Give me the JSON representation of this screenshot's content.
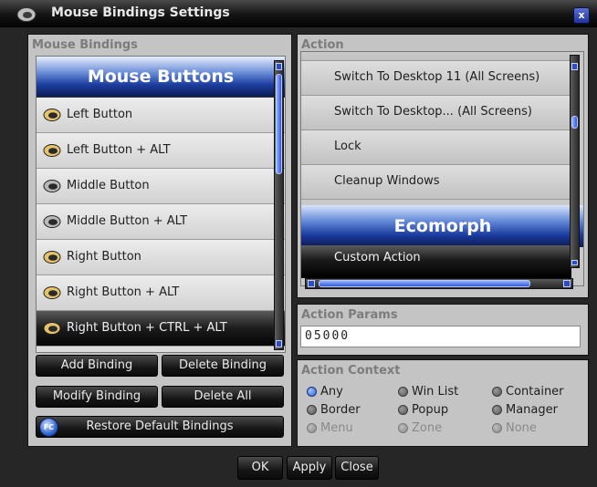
{
  "window": {
    "title": "Mouse Bindings Settings",
    "close_label": "x"
  },
  "mouse_bindings": {
    "section_label": "Mouse Bindings",
    "header": "Mouse Buttons",
    "items": [
      {
        "label": "Left Button"
      },
      {
        "label": "Left Button + ALT"
      },
      {
        "label": "Middle Button"
      },
      {
        "label": "Middle Button + ALT"
      },
      {
        "label": "Right Button"
      },
      {
        "label": "Right Button + ALT"
      },
      {
        "label": "Right Button + CTRL + ALT",
        "selected": true
      }
    ]
  },
  "binding_buttons": {
    "add": "Add Binding",
    "delete": "Delete Binding",
    "modify": "Modify Binding",
    "delete_all": "Delete All",
    "restore": "Restore Default Bindings",
    "restore_icon_text": "FC"
  },
  "action": {
    "section_label": "Action",
    "items_before": [
      "Switch To Desktop 11 (All Screens)",
      "Switch To Desktop... (All Screens)",
      "Lock",
      "Cleanup Windows"
    ],
    "group_header": "Ecomorph",
    "selected_item": "Custom Action"
  },
  "action_params": {
    "section_label": "Action Params",
    "value": "05000"
  },
  "action_context": {
    "section_label": "Action Context",
    "options": [
      {
        "label": "Any",
        "state": "on"
      },
      {
        "label": "Win List",
        "state": "off"
      },
      {
        "label": "Container",
        "state": "off"
      },
      {
        "label": "Border",
        "state": "off"
      },
      {
        "label": "Popup",
        "state": "off"
      },
      {
        "label": "Manager",
        "state": "off"
      },
      {
        "label": "Menu",
        "state": "dim"
      },
      {
        "label": "Zone",
        "state": "dim"
      },
      {
        "label": "None",
        "state": "dim"
      }
    ]
  },
  "footer": {
    "ok": "OK",
    "apply": "Apply",
    "close": "Close"
  }
}
